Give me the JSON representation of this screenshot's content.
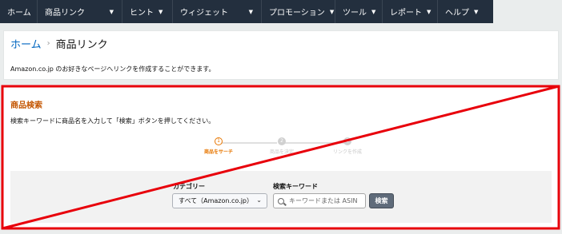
{
  "nav": {
    "items": [
      {
        "label": "ホーム",
        "caret": ""
      },
      {
        "label": "商品リンク",
        "caret": "▼"
      },
      {
        "label": "ヒント",
        "caret": "▼"
      },
      {
        "label": "ウィジェット",
        "caret": "▼"
      },
      {
        "label": "プロモーション",
        "caret": "▼"
      },
      {
        "label": "ツール",
        "caret": "▼"
      },
      {
        "label": "レポート",
        "caret": "▼"
      },
      {
        "label": "ヘルプ",
        "caret": "▼"
      }
    ]
  },
  "breadcrumb": {
    "home": "ホーム",
    "separator": "›",
    "current": "商品リンク"
  },
  "intro_text": "Amazon.co.jp のお好きなページへリンクを作成することができます。",
  "product_search": {
    "title": "商品検索",
    "instructions": "検索キーワードに商品名を入力して「検索」ボタンを押してください。",
    "steps": [
      {
        "number": "1",
        "label": "商品をサーチ"
      },
      {
        "number": "2",
        "label": "商品を決定"
      },
      {
        "number": "3",
        "label": "リンクを作成"
      }
    ],
    "category_label": "カテゴリー",
    "category_value": "すべて（Amazon.co.jp）",
    "keyword_label": "検索キーワード",
    "keyword_value": "",
    "keyword_placeholder": "キーワードまたは ASIN",
    "search_button": "検索"
  },
  "colors": {
    "nav_bg": "#232f3e",
    "link": "#0066c0",
    "section_title": "#c45500",
    "annotation": "#e8000b"
  }
}
